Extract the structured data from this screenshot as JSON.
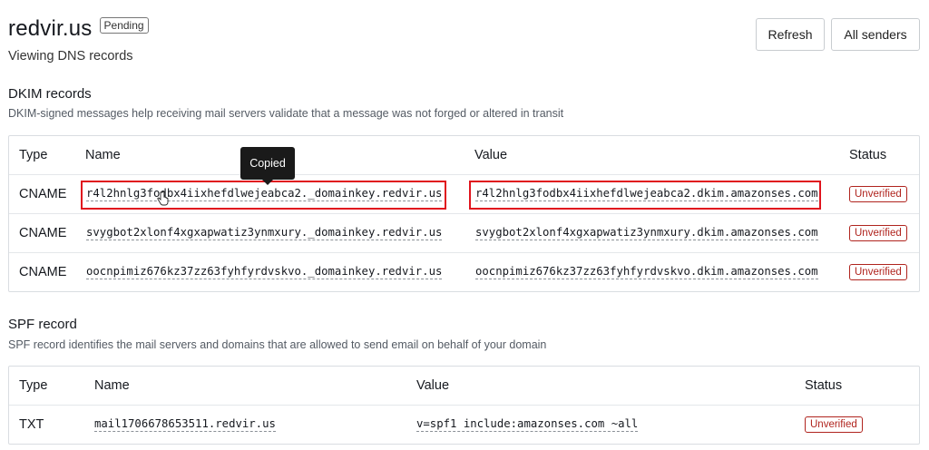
{
  "header": {
    "domain": "redvir.us",
    "badge": "Pending",
    "subtitle": "Viewing DNS records"
  },
  "actions": {
    "refresh_label": "Refresh",
    "all_senders_label": "All senders"
  },
  "dkim": {
    "title": "DKIM records",
    "description": "DKIM-signed messages help receiving mail servers validate that a message was not forged or altered in transit",
    "columns": {
      "type": "Type",
      "name": "Name",
      "value": "Value",
      "status": "Status"
    },
    "rows": [
      {
        "type": "CNAME",
        "name": "r4l2hnlg3fodbx4iixhefdlwejeabca2._domainkey.redvir.us",
        "value": "r4l2hnlg3fodbx4iixhefdlwejeabca2.dkim.amazonses.com",
        "status": "Unverified"
      },
      {
        "type": "CNAME",
        "name": "svygbot2xlonf4xgxapwatiz3ynmxury._domainkey.redvir.us",
        "value": "svygbot2xlonf4xgxapwatiz3ynmxury.dkim.amazonses.com",
        "status": "Unverified"
      },
      {
        "type": "CNAME",
        "name": "oocnpimiz676kz37zz63fyhfyrdvskvo._domainkey.redvir.us",
        "value": "oocnpimiz676kz37zz63fyhfyrdvskvo.dkim.amazonses.com",
        "status": "Unverified"
      }
    ]
  },
  "spf": {
    "title": "SPF record",
    "description": "SPF record identifies the mail servers and domains that are allowed to send email on behalf of your domain",
    "columns": {
      "type": "Type",
      "name": "Name",
      "value": "Value",
      "status": "Status"
    },
    "rows": [
      {
        "type": "TXT",
        "name": "mail1706678653511.redvir.us",
        "value": "v=spf1 include:amazonses.com ~all",
        "status": "Unverified"
      }
    ]
  },
  "tooltip": {
    "text": "Copied"
  },
  "colors": {
    "unverified": "#b0241e",
    "highlight": "#e0141e"
  }
}
